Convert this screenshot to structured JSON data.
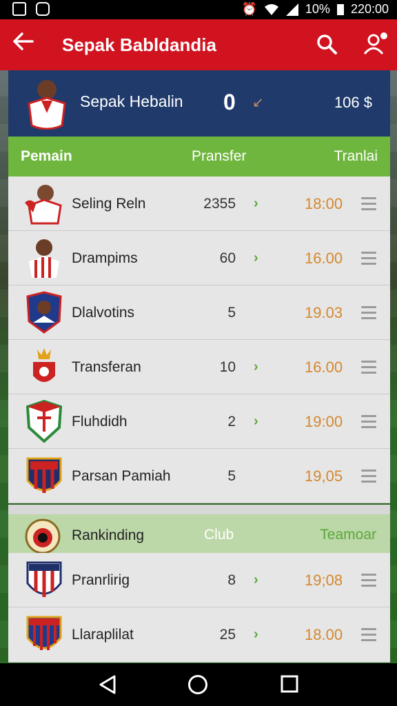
{
  "status": {
    "battery": "10%",
    "time": "220:00"
  },
  "appbar": {
    "title": "Sepak Babldandia"
  },
  "profile": {
    "name": "Sepak Hebalin",
    "score": "0",
    "amount": "106 $"
  },
  "columns": {
    "c1": "Pemain",
    "c2": "Pransfer",
    "c3": "Tranlai"
  },
  "rows": [
    {
      "name": "Seling Reln",
      "value": "2355",
      "time": "18:00"
    },
    {
      "name": "Drampims",
      "value": "60",
      "time": "16.00"
    },
    {
      "name": "Dlalvotins",
      "value": "5",
      "time": "19.03"
    },
    {
      "name": "Transferan",
      "value": "10",
      "time": "16.00"
    },
    {
      "name": "Fluhdidh",
      "value": "2",
      "time": "19:00"
    },
    {
      "name": "Parsan Pamiah",
      "value": "5",
      "time": "19,05"
    }
  ],
  "section": {
    "label": "Rankinding",
    "club": "Club",
    "team": "Teamoar"
  },
  "rows2": [
    {
      "name": "Pranrlirig",
      "value": "8",
      "time": "19;08"
    },
    {
      "name": "Llaraplilat",
      "value": "25",
      "time": "18.00"
    }
  ],
  "colors": {
    "appbar": "#d1121f",
    "header": "#1f3a6b",
    "accent_green": "#6fb63e",
    "time_orange": "#d4882e"
  }
}
